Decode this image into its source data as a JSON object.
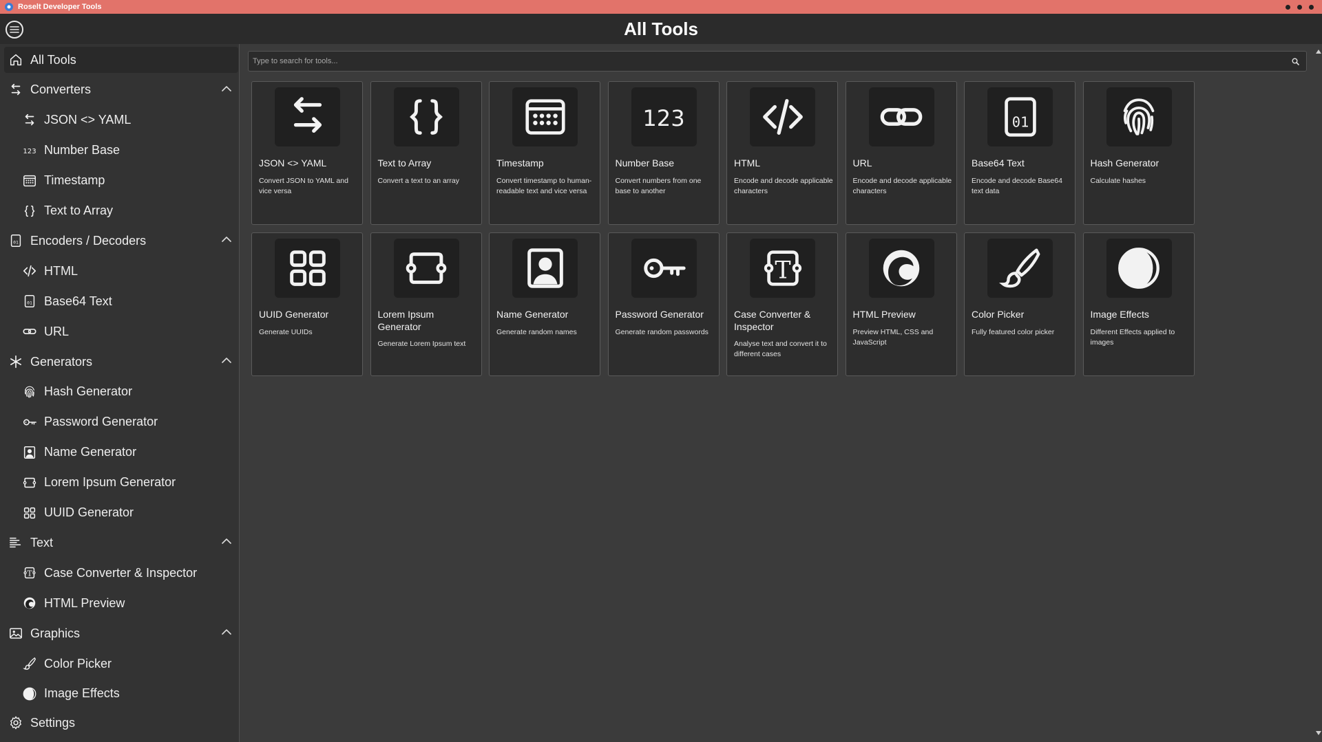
{
  "titlebar": {
    "title": "Roselt Developer Tools"
  },
  "header": {
    "title": "All Tools"
  },
  "search": {
    "placeholder": "Type to search for tools..."
  },
  "sidebar": {
    "all_tools": "All Tools",
    "sections": [
      {
        "label": "Converters",
        "icon": "arrows-swap-icon",
        "items": [
          {
            "label": "JSON <> YAML",
            "icon": "arrows-swap-icon"
          },
          {
            "label": "Number Base",
            "icon": "number-123-icon"
          },
          {
            "label": "Timestamp",
            "icon": "calendar-icon"
          },
          {
            "label": "Text to Array",
            "icon": "braces-icon"
          }
        ]
      },
      {
        "label": "Encoders / Decoders",
        "icon": "binary-file-icon",
        "items": [
          {
            "label": "HTML",
            "icon": "code-icon"
          },
          {
            "label": "Base64 Text",
            "icon": "binary-file-icon"
          },
          {
            "label": "URL",
            "icon": "link-icon"
          }
        ]
      },
      {
        "label": "Generators",
        "icon": "asterisk-icon",
        "items": [
          {
            "label": "Hash Generator",
            "icon": "fingerprint-icon"
          },
          {
            "label": "Password Generator",
            "icon": "key-icon"
          },
          {
            "label": "Name Generator",
            "icon": "person-icon"
          },
          {
            "label": "Lorem Ipsum Generator",
            "icon": "text-block-icon"
          },
          {
            "label": "UUID Generator",
            "icon": "grid-icon"
          }
        ]
      },
      {
        "label": "Text",
        "icon": "text-lines-icon",
        "items": [
          {
            "label": "Case Converter & Inspector",
            "icon": "text-case-icon"
          },
          {
            "label": "HTML Preview",
            "icon": "browser-icon"
          }
        ]
      },
      {
        "label": "Graphics",
        "icon": "image-icon",
        "items": [
          {
            "label": "Color Picker",
            "icon": "brush-icon"
          },
          {
            "label": "Image Effects",
            "icon": "contrast-icon"
          }
        ]
      }
    ],
    "settings": "Settings"
  },
  "tools": [
    {
      "title": "JSON <> YAML",
      "description": "Convert JSON to YAML and vice versa",
      "icon": "arrows-swap-icon"
    },
    {
      "title": "Text to Array",
      "description": "Convert a text to an array",
      "icon": "braces-icon"
    },
    {
      "title": "Timestamp",
      "description": "Convert timestamp to human-readable text and vice versa",
      "icon": "calendar-icon"
    },
    {
      "title": "Number Base",
      "description": "Convert numbers from one base to another",
      "icon": "number-123-icon"
    },
    {
      "title": "HTML",
      "description": "Encode and decode applicable characters",
      "icon": "code-icon"
    },
    {
      "title": "URL",
      "description": "Encode and decode applicable characters",
      "icon": "link-icon"
    },
    {
      "title": "Base64 Text",
      "description": "Encode and decode Base64 text data",
      "icon": "binary-file-icon"
    },
    {
      "title": "Hash Generator",
      "description": "Calculate hashes",
      "icon": "fingerprint-icon"
    },
    {
      "title": "UUID Generator",
      "description": "Generate UUIDs",
      "icon": "grid-icon"
    },
    {
      "title": "Lorem Ipsum Generator",
      "description": "Generate Lorem Ipsum text",
      "icon": "text-block-icon"
    },
    {
      "title": "Name Generator",
      "description": "Generate random names",
      "icon": "person-icon"
    },
    {
      "title": "Password Generator",
      "description": "Generate random passwords",
      "icon": "key-icon"
    },
    {
      "title": "Case Converter & Inspector",
      "description": "Analyse text and convert it to different cases",
      "icon": "text-case-icon"
    },
    {
      "title": "HTML Preview",
      "description": "Preview HTML, CSS and JavaScript",
      "icon": "browser-icon"
    },
    {
      "title": "Color Picker",
      "description": "Fully featured color picker",
      "icon": "brush-icon"
    },
    {
      "title": "Image Effects",
      "description": "Different Effects applied to images",
      "icon": "contrast-icon"
    }
  ],
  "colors": {
    "titlebar": "#e2736a",
    "header": "#2b2b2b",
    "sidebar": "#333333",
    "content": "#3b3b3b",
    "card": "#2d2d2d",
    "icon_tile": "#202020"
  }
}
